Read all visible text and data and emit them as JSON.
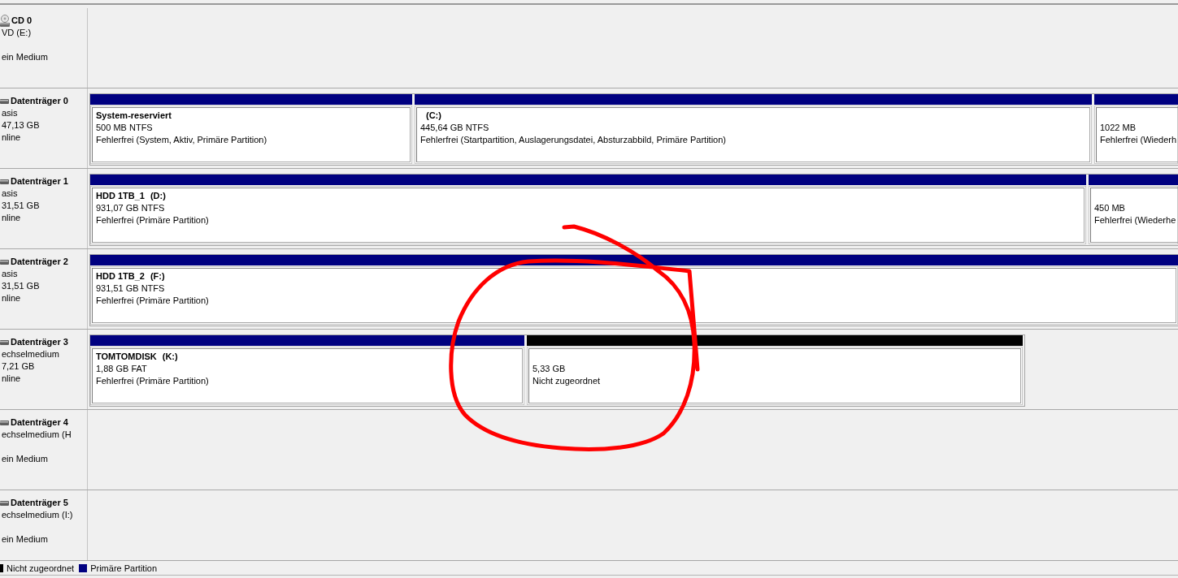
{
  "disks": [
    {
      "kind": "cd",
      "name": "CD 0",
      "type": "VD (E:)",
      "status": "ein Medium"
    },
    {
      "kind": "disk",
      "name": "Datenträger 0",
      "type": "asis",
      "size": "47,13 GB",
      "status": "nline",
      "partitions": [
        {
          "kind": "primary",
          "label": "System-reserviert",
          "size": "500 MB NTFS",
          "status": "Fehlerfrei (System, Aktiv, Primäre Partition)"
        },
        {
          "kind": "primary",
          "drive": "(C:)",
          "size": "445,64 GB NTFS",
          "status": "Fehlerfrei (Startpartition, Auslagerungsdatei, Absturzabbild, Primäre Partition)"
        },
        {
          "kind": "primary",
          "size": "1022 MB",
          "status": "Fehlerfrei (Wiederh"
        }
      ]
    },
    {
      "kind": "disk",
      "name": "Datenträger 1",
      "type": "asis",
      "size": "31,51 GB",
      "status": "nline",
      "partitions": [
        {
          "kind": "primary",
          "label": "HDD 1TB_1",
          "drive": "(D:)",
          "size": "931,07 GB NTFS",
          "status": "Fehlerfrei (Primäre Partition)"
        },
        {
          "kind": "primary",
          "size": "450 MB",
          "status": "Fehlerfrei (Wiederhe"
        }
      ]
    },
    {
      "kind": "disk",
      "name": "Datenträger 2",
      "type": "asis",
      "size": "31,51 GB",
      "status": "nline",
      "partitions": [
        {
          "kind": "primary",
          "label": "HDD 1TB_2",
          "drive": "(F:)",
          "size": "931,51 GB NTFS",
          "status": "Fehlerfrei (Primäre Partition)"
        }
      ]
    },
    {
      "kind": "disk",
      "name": "Datenträger 3",
      "type": "echselmedium",
      "size": "7,21 GB",
      "status": "nline",
      "partitions": [
        {
          "kind": "primary",
          "label": "TOMTOMDISK",
          "drive": "(K:)",
          "size": "1,88 GB FAT",
          "status": "Fehlerfrei (Primäre Partition)"
        },
        {
          "kind": "unallocated",
          "size": "5,33 GB",
          "status": "Nicht zugeordnet"
        }
      ]
    },
    {
      "kind": "disk",
      "name": "Datenträger 4",
      "type": "echselmedium (H",
      "status": "ein Medium"
    },
    {
      "kind": "disk",
      "name": "Datenträger 5",
      "type": "echselmedium (I:)",
      "status": "ein Medium"
    }
  ],
  "legend": [
    {
      "kind": "unallocated",
      "label": "Nicht zugeordnet",
      "color": "#000000"
    },
    {
      "kind": "primary",
      "label": "Primäre Partition",
      "color": "#000080"
    }
  ],
  "annotation": {
    "kind": "freehand-circle"
  }
}
